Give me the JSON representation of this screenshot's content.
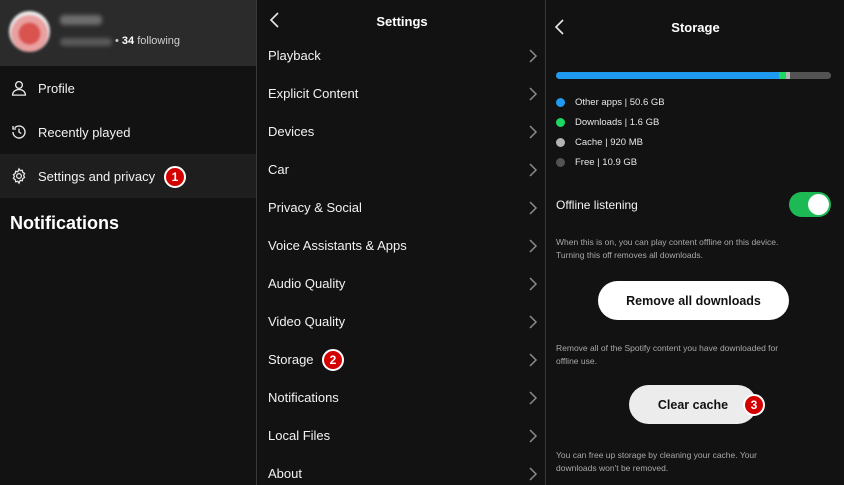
{
  "profile": {
    "following_count": "34",
    "following_label": "following",
    "separator": "•"
  },
  "sidebar": {
    "items": [
      {
        "label": "Profile",
        "icon": "user-icon"
      },
      {
        "label": "Recently played",
        "icon": "history-icon"
      },
      {
        "label": "Settings and privacy",
        "icon": "gear-icon"
      }
    ],
    "notifications_heading": "Notifications"
  },
  "settings": {
    "title": "Settings",
    "items": [
      {
        "label": "Playback"
      },
      {
        "label": "Explicit Content"
      },
      {
        "label": "Devices"
      },
      {
        "label": "Car"
      },
      {
        "label": "Privacy & Social"
      },
      {
        "label": "Voice Assistants & Apps"
      },
      {
        "label": "Audio Quality"
      },
      {
        "label": "Video Quality"
      },
      {
        "label": "Storage"
      },
      {
        "label": "Notifications"
      },
      {
        "label": "Local Files"
      },
      {
        "label": "About"
      }
    ]
  },
  "storage": {
    "title": "Storage",
    "usage": [
      {
        "label": "Other apps | 50.6 GB",
        "color": "#1e9bf0",
        "fraction": 0.8107
      },
      {
        "label": "Downloads | 1.6 GB",
        "color": "#1ed760",
        "fraction": 0.0256
      },
      {
        "label": "Cache | 920 MB",
        "color": "#b3b3b3",
        "fraction": 0.0147
      },
      {
        "label": "Free | 10.9 GB",
        "color": "#535353",
        "fraction": 0.149
      }
    ],
    "offline_label": "Offline listening",
    "offline_enabled": true,
    "offline_help": "When this is on, you can play content offline on this device. Turning this off removes all downloads.",
    "remove_button": "Remove all downloads",
    "remove_help": "Remove all of the Spotify content you have downloaded for offline use.",
    "cache_button": "Clear cache",
    "cache_help": "You can free up storage by cleaning your cache. Your downloads won't be removed."
  },
  "badges": [
    "1",
    "2",
    "3"
  ],
  "colors": {
    "accent_green": "#1db954",
    "badge_red": "#d40000",
    "background": "#121212"
  }
}
